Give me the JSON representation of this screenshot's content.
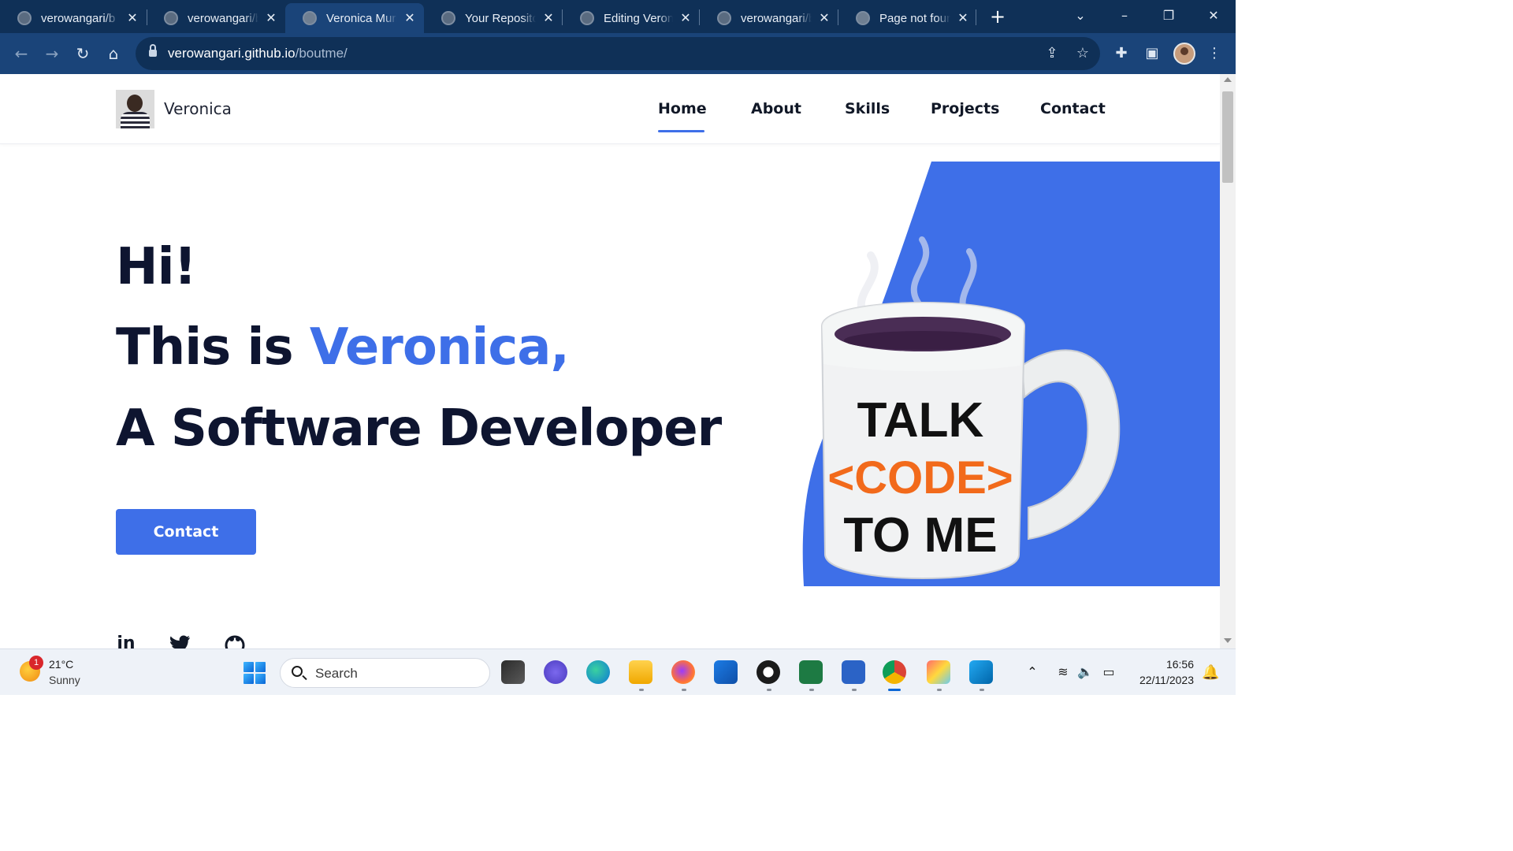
{
  "browser": {
    "tabs": [
      {
        "title": "verowangari/b",
        "icon": "github-icon"
      },
      {
        "title": "verowangari/b",
        "icon": "github-icon"
      },
      {
        "title": "Veronica Muri",
        "icon": "globe-icon",
        "active": true
      },
      {
        "title": "Your Reposito",
        "icon": "github-icon"
      },
      {
        "title": "Editing Veroni",
        "icon": "github-icon"
      },
      {
        "title": "verowangari/b",
        "icon": "github-icon"
      },
      {
        "title": "Page not foun",
        "icon": "globe-icon"
      }
    ],
    "url_host": "verowangari.github.io",
    "url_path": "/boutme/"
  },
  "site": {
    "name": "Veronica",
    "nav": [
      {
        "label": "Home",
        "active": true
      },
      {
        "label": "About"
      },
      {
        "label": "Skills"
      },
      {
        "label": "Projects"
      },
      {
        "label": "Contact"
      }
    ]
  },
  "hero": {
    "greeting": "Hi!",
    "intro_prefix": "This is",
    "intro_name": "Veronica,",
    "role": "A Software Developer",
    "cta_label": "Contact",
    "socials": [
      "linkedin-icon",
      "twitter-icon",
      "github-icon"
    ],
    "mug_lines": [
      "TALK",
      "<CODE>",
      "TO ME"
    ]
  },
  "taskbar": {
    "weather_temp": "21°C",
    "weather_desc": "Sunny",
    "weather_badge": "1",
    "search_label": "Search",
    "time": "16:56",
    "date": "22/11/2023"
  },
  "colors": {
    "accent": "#3e6fe8",
    "heading": "#0e1530",
    "browser_frame": "#0f3057",
    "mug_code": "#f26a1b"
  }
}
